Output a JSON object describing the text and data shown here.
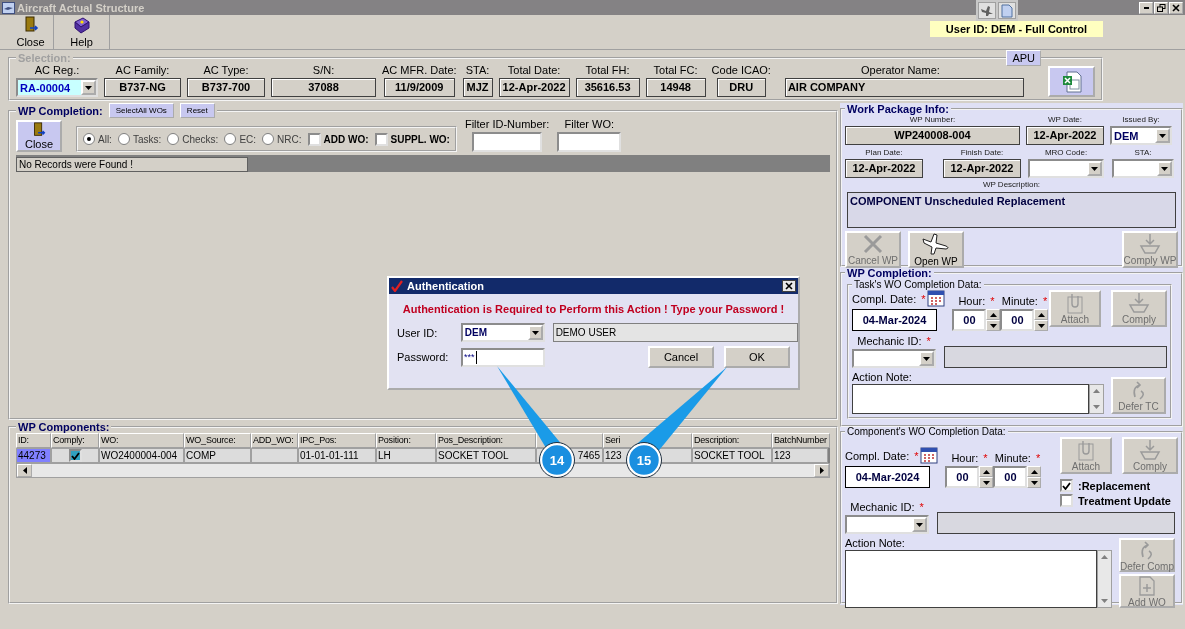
{
  "window": {
    "title": "Aircraft Actual Structure"
  },
  "toolbar": [
    {
      "label": "Close"
    },
    {
      "label": "Help"
    }
  ],
  "user_badge": "User ID: DEM - Full Control",
  "selection": {
    "title": "Selection:",
    "apu_button": "APU",
    "fields": [
      {
        "label": "AC Reg.:",
        "value": "RA-00004",
        "kind": "combo"
      },
      {
        "label": "AC Family:",
        "value": "B737-NG",
        "kind": "display"
      },
      {
        "label": "AC Type:",
        "value": "B737-700",
        "kind": "display"
      },
      {
        "label": "S/N:",
        "value": "37088",
        "kind": "display"
      },
      {
        "label": "AC MFR. Date:",
        "value": "11/9/2009",
        "kind": "display"
      },
      {
        "label": "STA:",
        "value": "MJZ",
        "kind": "display"
      },
      {
        "label": "Total Date:",
        "value": "12-Apr-2022",
        "kind": "display"
      },
      {
        "label": "Total FH:",
        "value": "35616.53",
        "kind": "display"
      },
      {
        "label": "Total FC:",
        "value": "14948",
        "kind": "display"
      },
      {
        "label": "Code ICAO:",
        "value": "DRU",
        "kind": "display"
      },
      {
        "label": "Operator Name:",
        "value": "AIR COMPANY",
        "kind": "text"
      }
    ]
  },
  "wp_completion": {
    "title": "WP Completion:",
    "buttons": [
      "SelectAll WOs",
      "Reset"
    ],
    "close_button": "Close",
    "filters": [
      {
        "label": "All:",
        "kind": "radio",
        "selected": true
      },
      {
        "label": "Tasks:",
        "kind": "radio",
        "selected": false
      },
      {
        "label": "Checks:",
        "kind": "radio",
        "selected": false
      },
      {
        "label": "EC:",
        "kind": "radio",
        "selected": false
      },
      {
        "label": "NRC:",
        "kind": "radio",
        "selected": false
      },
      {
        "label": "ADD WO:",
        "kind": "check",
        "checked": false
      },
      {
        "label": "SUPPL. WO:",
        "kind": "check",
        "checked": false
      }
    ],
    "filter_fields": [
      {
        "label": "Filter ID-Number:"
      },
      {
        "label": "Filter WO:"
      }
    ],
    "grid_message": "No Records were Found !"
  },
  "components": {
    "title": "WP Components:",
    "columns": [
      {
        "label": "ID:"
      },
      {
        "label": "Comply:"
      },
      {
        "label": "WO:"
      },
      {
        "label": "WO_Source:"
      },
      {
        "label": "ADD_WO:"
      },
      {
        "label": "IPC_Pos:"
      },
      {
        "label": "Position:"
      },
      {
        "label": "Pos_Description:"
      },
      {},
      {
        "label": "Seri"
      },
      {
        "label": "Description:"
      },
      {
        "label": "BatchNumber"
      }
    ],
    "rows": [
      {
        "selected": true,
        "comply": true,
        "cells": [
          "44273",
          null,
          "WO2400004-004",
          "COMP",
          null,
          "01-01-01-111",
          "LH",
          "SOCKET TOOL",
          "7465",
          "123",
          "SOCKET TOOL",
          "123"
        ]
      }
    ]
  },
  "callouts": [
    {
      "label": "14"
    },
    {
      "label": "15"
    }
  ],
  "dialog": {
    "title": "Authentication",
    "message": "Authentication is Required to Perform this Action ! Type your Password !",
    "user_label": "User ID:",
    "user_id": "DEM",
    "user_name": "DEMO USER",
    "password_label": "Password:",
    "password": "***",
    "buttons": [
      "Cancel",
      "OK"
    ]
  },
  "work_package": {
    "title": "Work Package Info:",
    "fields": [
      {
        "label": "WP Number:",
        "value": "WP240008-004",
        "kind": "display"
      },
      {
        "label": "WP Date:",
        "value": "12-Apr-2022",
        "kind": "display"
      },
      {
        "label": "Issued By:",
        "value": "DEM",
        "kind": "combo"
      },
      {
        "label": "Plan Date:",
        "value": "12-Apr-2022",
        "kind": "display"
      },
      {
        "label": "Finish Date:",
        "value": "12-Apr-2022",
        "kind": "display"
      },
      {
        "label": "MRO Code:",
        "kind": "combo"
      },
      {
        "label": "STA:",
        "kind": "combo"
      }
    ],
    "description_label": "WP Description:",
    "description": "COMPONENT Unscheduled Replacement",
    "buttons": [
      {
        "label": "Cancel WP",
        "disabled": true
      },
      {
        "label": "Open WP",
        "disabled": false
      },
      {
        "label": "Comply WP",
        "disabled": true
      }
    ]
  },
  "wp_completion_panel": {
    "title": "WP Completion:",
    "task": {
      "title": "Task's WO Completion Data:",
      "date": {
        "label": "Compl. Date:",
        "required_sign": "*",
        "value": "04-Mar-2024"
      },
      "hour": {
        "label": "Hour:",
        "required_sign": "*",
        "value": "00"
      },
      "minute": {
        "label": "Minute:",
        "required_sign": "*",
        "value": "00"
      },
      "mechanic": {
        "label": "Mechanic ID:",
        "required_sign": "*"
      },
      "note_label": "Action Note:",
      "buttons": [
        {
          "label": "Attach",
          "disabled": true
        },
        {
          "label": "Comply",
          "disabled": true
        },
        {
          "label": "Defer TC",
          "disabled": true
        }
      ]
    },
    "component": {
      "title": "Component's WO Completion Data:",
      "date": {
        "label": "Compl. Date:",
        "required_sign": "*",
        "value": "04-Mar-2024"
      },
      "hour": {
        "label": "Hour:",
        "required_sign": "*",
        "value": "00"
      },
      "minute": {
        "label": "Minute:",
        "required_sign": "*",
        "value": "00"
      },
      "mechanic": {
        "label": "Mechanic ID:",
        "required_sign": "*"
      },
      "note_label": "Action Note:",
      "checks": [
        {
          "label": ":Replacement",
          "checked": true
        },
        {
          "label": "Treatment Update",
          "checked": false
        }
      ],
      "buttons": [
        {
          "label": "Attach",
          "disabled": true
        },
        {
          "label": "Comply",
          "disabled": true
        },
        {
          "label": "Defer Comp",
          "disabled": true
        },
        {
          "label": "Add WO",
          "disabled": true
        }
      ]
    }
  }
}
